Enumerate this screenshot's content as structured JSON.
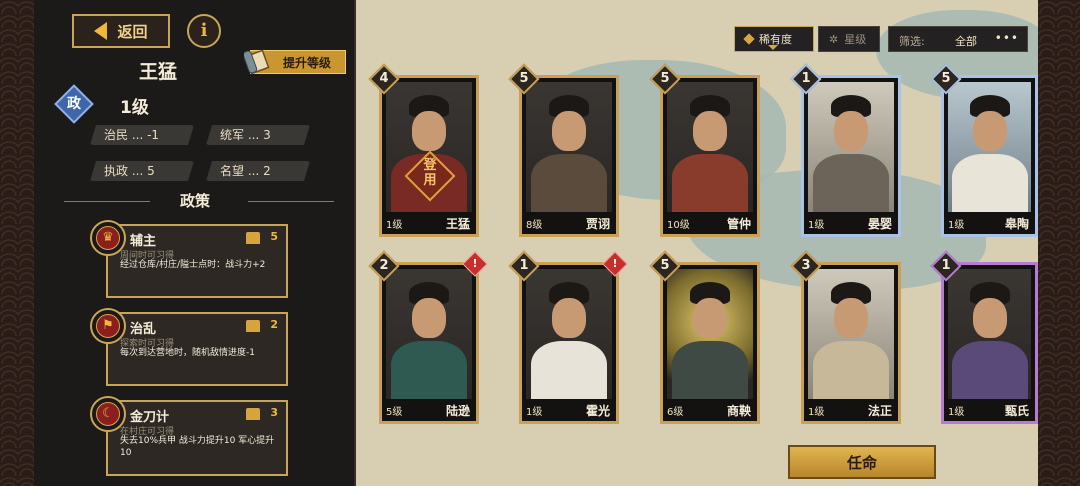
{
  "hero": {
    "name": "王猛",
    "faction_badge": "政",
    "level": "1级",
    "upgrade_label": "提升等级"
  },
  "nav": {
    "back_label": "返回",
    "info_label": "i"
  },
  "stats": [
    {
      "label": "治民 ... -1"
    },
    {
      "label": "统军 ... 3"
    },
    {
      "label": "执政 ... 5"
    },
    {
      "label": "名望 ... 2"
    }
  ],
  "policy_section_title": "政策",
  "policies": [
    {
      "name": "辅主",
      "cost": "5",
      "sub": "周间时可习得",
      "desc": "经过仓库/村庄/隘士点时：战斗力+2",
      "icon": "crown"
    },
    {
      "name": "治乱",
      "cost": "2",
      "sub": "探索时可习得",
      "desc": "每次到达营地时，随机敌情进度-1",
      "icon": "flag"
    },
    {
      "name": "金刀计",
      "cost": "3",
      "sub": "在村庄可习得",
      "desc": "失去10%兵甲 战斗力提升10 军心提升10",
      "icon": "moon"
    }
  ],
  "tabs": {
    "rarity": "稀有度",
    "star": "星级"
  },
  "filter": {
    "label": "筛选:",
    "value": "全部",
    "more": "•••"
  },
  "cards": [
    {
      "name": "王猛",
      "level": "1级",
      "stars": "4",
      "deployed": "登用",
      "alert": false,
      "frame": "gold"
    },
    {
      "name": "贾诩",
      "level": "8级",
      "stars": "5",
      "alert": false,
      "frame": "gold"
    },
    {
      "name": "管仲",
      "level": "10级",
      "stars": "5",
      "alert": false,
      "frame": "gold"
    },
    {
      "name": "晏婴",
      "level": "1级",
      "stars": "1",
      "alert": false,
      "frame": "blue"
    },
    {
      "name": "皋陶",
      "level": "1级",
      "stars": "5",
      "alert": false,
      "frame": "blue"
    },
    {
      "name": "陆逊",
      "level": "5级",
      "stars": "2",
      "alert": true,
      "frame": "gold"
    },
    {
      "name": "霍光",
      "level": "1级",
      "stars": "1",
      "alert": true,
      "frame": "gold"
    },
    {
      "name": "商鞅",
      "level": "6级",
      "stars": "5",
      "alert": false,
      "frame": "gold"
    },
    {
      "name": "法正",
      "level": "1级",
      "stars": "3",
      "alert": false,
      "frame": "gold"
    },
    {
      "name": "甄氏",
      "level": "1级",
      "stars": "1",
      "alert": false,
      "frame": "purple"
    }
  ],
  "alert_mark": "!",
  "appoint_label": "任命",
  "colors": {
    "gold_frame": "#c9a055",
    "blue_frame": "#a9c2e6",
    "purple_frame": "#b77bd2",
    "button_gold": "#c9962f",
    "gov_badge": "#3f66a8"
  }
}
